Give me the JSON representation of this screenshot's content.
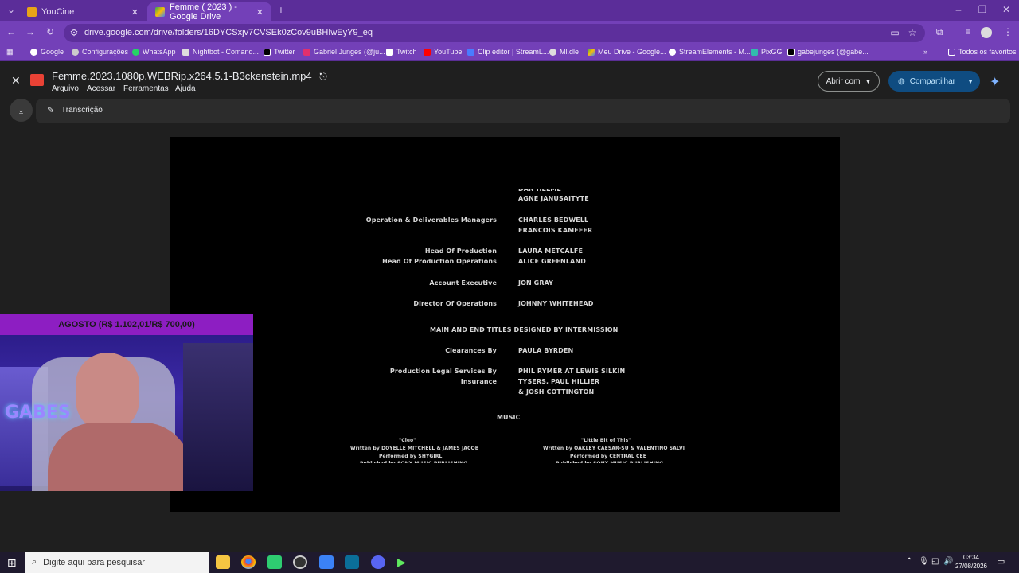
{
  "browser": {
    "tabs": [
      {
        "label": "YouCine",
        "close": "✕"
      },
      {
        "label": "Femme ( 2023 ) - Google Drive",
        "close": "✕"
      }
    ],
    "new_tab": "+",
    "url": "drive.google.com/drive/folders/16DYCSxjv7CVSEk0zCov9uBHIwEyY9_eq",
    "bookmarks": [
      "Google",
      "Configurações",
      "WhatsApp",
      "Nightbot - Comand...",
      "Twitter",
      "Gabriel Junges (@ju...",
      "Twitch",
      "YouTube",
      "Clip editor | StreamL...",
      "Ml.dle",
      "Meu Drive - Google...",
      "StreamElements - M...",
      "PixGG",
      "gabejunges (@gabe...",
      "Todos os favoritos"
    ]
  },
  "drive": {
    "file_name": "Femme.2023.1080p.WEBRip.x264.5.1-B3ckenstein.mp4",
    "menus": [
      "Arquivo",
      "Acessar",
      "Ferramentas",
      "Ajuda"
    ],
    "open_with": "Abrir com",
    "share": "Compartilhar",
    "transcription": "Transcrição"
  },
  "credits": {
    "top1": "DAN HELME",
    "top2": "AGNE JANUSAITYTE",
    "r1_role": "Operation & Deliverables Managers",
    "r1_names": [
      "CHARLES BEDWELL",
      "FRANCOIS KAMFFER"
    ],
    "r2_roles": [
      "Head Of Production",
      "Head Of Production Operations"
    ],
    "r2_names": [
      "LAURA METCALFE",
      "ALICE GREENLAND"
    ],
    "r3_role": "Account Executive",
    "r3_name": "JON GRAY",
    "r4_role": "Director Of Operations",
    "r4_name": "JOHNNY WHITEHEAD",
    "titles": "MAIN AND END TITLES DESIGNED BY INTERMISSION",
    "r5_role": "Clearances By",
    "r5_name": "PAULA BYRDEN",
    "r6_roles": [
      "Production Legal Services By",
      "Insurance"
    ],
    "r6_names": [
      "PHIL RYMER AT LEWIS SILKIN",
      "TYSERS, PAUL HILLIER",
      "& JOSH COTTINGTON"
    ],
    "music": "MUSIC",
    "song1": {
      "title": "\"Cleo\"",
      "written": "Written by DOYELLE MITCHELL & JAMES JACOB",
      "performed": "Performed by SHYGIRL",
      "published": "Published by SONY MUSIC PUBLISHING"
    },
    "song2": {
      "title": "\"Little Bit of This\"",
      "written": "Written by OAKLEY CAESAR-SU & VALENTINO SALVI",
      "performed": "Performed by CENTRAL CEE",
      "published": "Published by SONY MUSIC PUBLISHING"
    }
  },
  "overlay": {
    "banner": "AGOSTO (R$ 1.102,01/R$ 700,00)",
    "sign": "GABES"
  },
  "taskbar": {
    "search_placeholder": "Digite aqui para pesquisar",
    "time": "03:34",
    "date": "27/08/2026"
  }
}
